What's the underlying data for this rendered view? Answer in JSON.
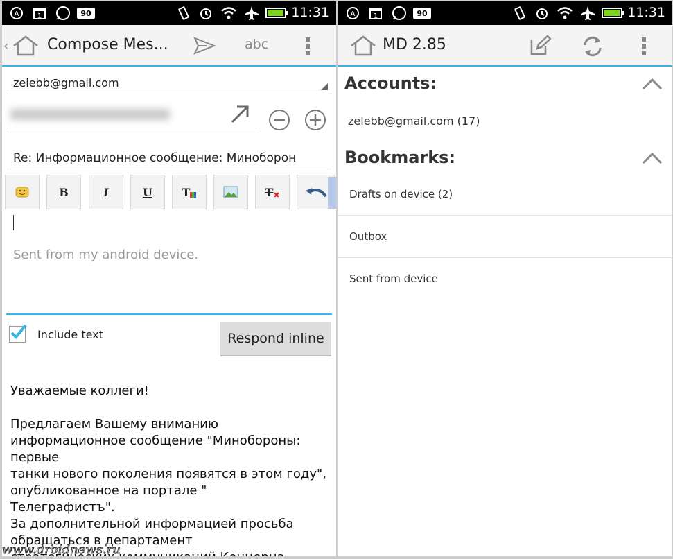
{
  "status_bar": {
    "time": "11:31",
    "badge": "90",
    "calendar_day": "1",
    "left_icons": [
      "autorotate-icon",
      "calendar-icon",
      "whatsapp-icon",
      "badge-90-icon"
    ],
    "right_icons": [
      "vibrate-icon",
      "alarm-icon",
      "wifi-icon",
      "airplane-icon",
      "battery-icon"
    ],
    "battery_level": 0.9,
    "battery_color": "#7ed321"
  },
  "compose": {
    "back_icon": "back-caret-icon",
    "app_icon": "home-icon",
    "title": "Compose Mes...",
    "send_icon": "send-icon",
    "spellcheck_label": "abc",
    "overflow_icon": "overflow-menu-icon",
    "from_account": "zelebb@gmail.com",
    "recipient_hidden": "(blurred recipient)",
    "subject": "Re: Информационное сообщение: Миноборон",
    "format_buttons": [
      {
        "name": "emoji-icon"
      },
      {
        "name": "bold-button",
        "label": "B"
      },
      {
        "name": "italic-button",
        "label": "I"
      },
      {
        "name": "underline-button",
        "label": "U"
      },
      {
        "name": "text-color-icon",
        "label": "T"
      },
      {
        "name": "insert-image-icon"
      },
      {
        "name": "clear-format-icon",
        "label": "T"
      },
      {
        "name": "undo-icon"
      }
    ],
    "signature_placeholder": "Sent from my android device.",
    "include_text_label": "Include text",
    "include_text_checked": true,
    "respond_inline_label": "Respond inline",
    "quoted_body": [
      "Уважаемые коллеги!",
      "Предлагаем Вашему вниманию информационное сообщение \"Минобороны: первые\nтанки нового поколения появятся в этом году\", опубликованное на портале \"\nТелеграфистъ\".\nЗа дополнительной информацией просьба обращаться в департамент\nстратегических коммуникаций Концерна"
    ],
    "accent_color": "#33b5e5"
  },
  "accounts_screen": {
    "app_icon": "home-icon",
    "title": "MD 2.85",
    "compose_icon": "compose-icon",
    "refresh_icon": "refresh-icon",
    "overflow_icon": "overflow-menu-icon",
    "accounts_header": "Accounts:",
    "accounts": [
      "zelebb@gmail.com (17)"
    ],
    "bookmarks_header": "Bookmarks:",
    "bookmarks": [
      "Drafts on device (2)",
      "Outbox",
      "Sent from device"
    ]
  },
  "watermark": "www.droidnews.ru"
}
